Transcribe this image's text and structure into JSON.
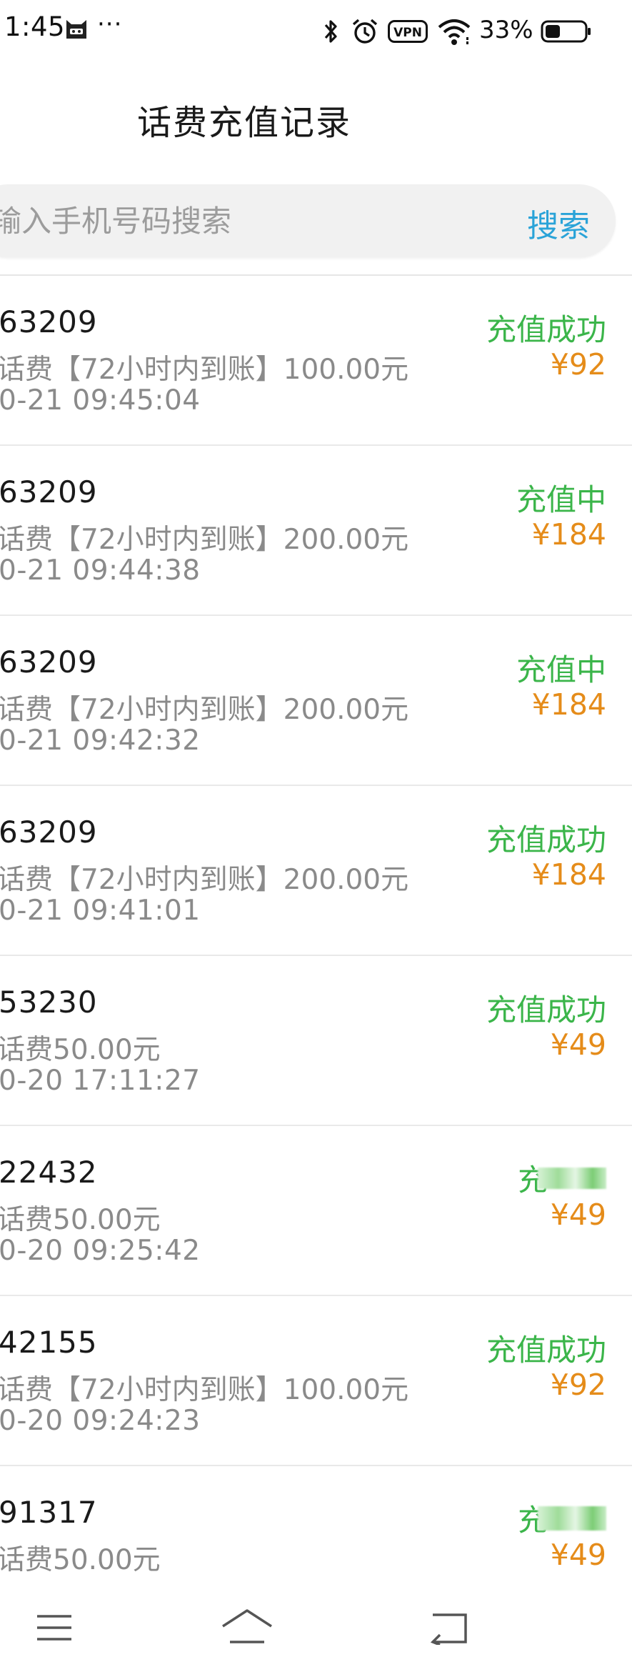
{
  "status_bar": {
    "time": "1:45",
    "dots": "···",
    "battery": "33%",
    "vpn_label": "VPN",
    "icons": [
      "cat-notification-icon",
      "bluetooth-icon",
      "alarm-icon",
      "vpn-icon",
      "wifi-icon",
      "battery-icon"
    ]
  },
  "header": {
    "title": "话费充值记录"
  },
  "search": {
    "placeholder": "输入手机号码搜索",
    "button_label": "搜索"
  },
  "colors": {
    "success": "#3bb54a",
    "price": "#e58c1a",
    "search_button": "#2aa3d8",
    "secondary_text": "#8a8a8a"
  },
  "records": [
    {
      "phone": "63209",
      "product": "话费【72小时内到账】100.00元",
      "time": "0-21 09:45:04",
      "status": "充值成功",
      "price": "¥92"
    },
    {
      "phone": "63209",
      "product": "话费【72小时内到账】200.00元",
      "time": "0-21 09:44:38",
      "status": "充值中",
      "price": "¥184"
    },
    {
      "phone": "63209",
      "product": "话费【72小时内到账】200.00元",
      "time": "0-21 09:42:32",
      "status": "充值中",
      "price": "¥184"
    },
    {
      "phone": "63209",
      "product": "话费【72小时内到账】200.00元",
      "time": "0-21 09:41:01",
      "status": "充值成功",
      "price": "¥184"
    },
    {
      "phone": "53230",
      "product": "话费50.00元",
      "time": "0-20 17:11:27",
      "status": "充值成功",
      "price": "¥49"
    },
    {
      "phone": "22432",
      "product": "话费50.00元",
      "time": "0-20 09:25:42",
      "status": "充",
      "price": "¥49"
    },
    {
      "phone": "42155",
      "product": "话费【72小时内到账】100.00元",
      "time": "0-20 09:24:23",
      "status": "充值成功",
      "price": "¥92"
    },
    {
      "phone": "91317",
      "product": "话费50.00元",
      "time": "",
      "status": "充",
      "price": "¥49"
    }
  ],
  "nav_bar": {
    "icons": [
      "menu-icon",
      "home-icon",
      "back-icon"
    ]
  }
}
